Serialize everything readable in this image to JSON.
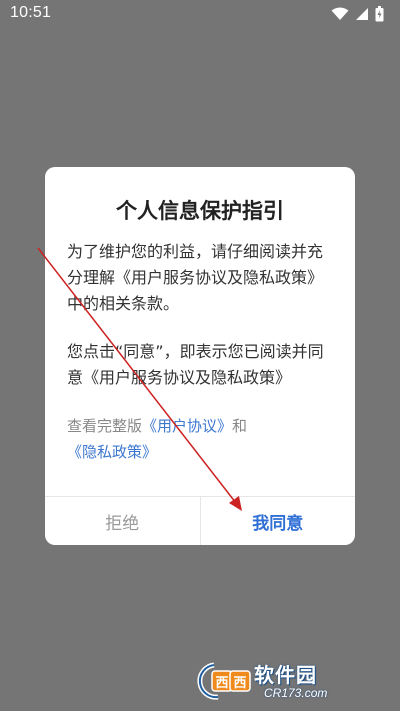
{
  "status_bar": {
    "time": "10:51",
    "icons": [
      "wifi-icon",
      "signal-icon",
      "battery-icon"
    ]
  },
  "dialog": {
    "title": "个人信息保护指引",
    "paragraph1": "为了维护您的利益，请仔细阅读并充分理解《用户服务协议及隐私政策》中的相关条款。",
    "paragraph2": "您点击“同意”，即表示您已阅读并同意《用户服务协议及隐私政策》",
    "links_prefix": "查看完整版",
    "user_agreement_link": "《用户协议》",
    "links_and": "和",
    "privacy_policy_link": "《隐私政策》",
    "reject_label": "拒绝",
    "agree_label": "我同意"
  },
  "watermark": {
    "title": "软件园",
    "url": "CR173.com"
  },
  "colors": {
    "overlay": "#757575",
    "link": "#3d78d0",
    "agree_button": "#2f6fd6",
    "annotation_arrow": "#cc2222"
  }
}
